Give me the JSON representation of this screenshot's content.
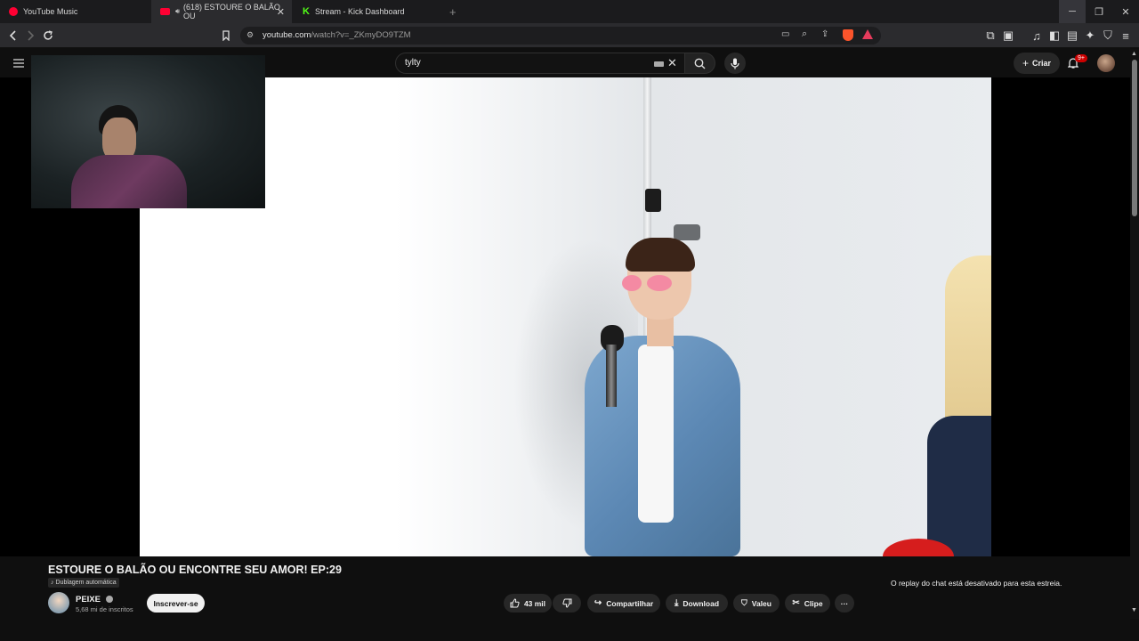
{
  "browser": {
    "tabs": [
      {
        "title": "YouTube Music",
        "color": "#ff0033"
      },
      {
        "title": "(618) ESTOURE O BALÃO OU",
        "color": "#ff0033"
      },
      {
        "title": "Stream - Kick Dashboard",
        "color": "#53fc18"
      }
    ],
    "new_tab": "+",
    "url_main": "youtube.com",
    "url_path": "/watch?v=_ZKmyDO9TZM",
    "window_controls": [
      "minimize-icon",
      "restore-icon",
      "close-icon"
    ]
  },
  "youtube": {
    "search_query": "tylty",
    "create_label": "Criar",
    "notification_count": "9+"
  },
  "video": {
    "title": "ESTOURE O BALÃO OU ENCONTRE SEU AMOR! EP:29",
    "dub_badge": "Dublagem automática",
    "channel_name": "PEIXE",
    "channel_subs": "5,68 mi de inscritos",
    "subscribe_label": "Inscrever-se",
    "like_count": "43 mil",
    "share_label": "Compartilhar",
    "download_label": "Download",
    "thanks_label": "Valeu",
    "clip_label": "Clipe",
    "more_label": "···",
    "chat_note": "O replay do chat está desativado para esta estreia."
  },
  "colors": {
    "accent_red": "#ff0033",
    "kick_green": "#53fc18",
    "background": "#0f0f0f"
  }
}
